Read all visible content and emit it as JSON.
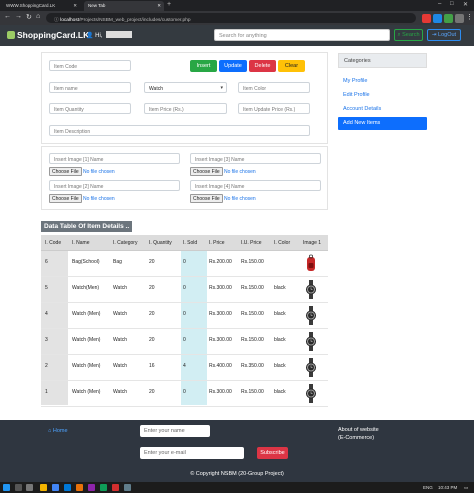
{
  "browser": {
    "tabs": [
      {
        "label": "WWW.ShoppingCard.LK"
      },
      {
        "label": "New Tab"
      }
    ],
    "url_host": "localhost",
    "url_path": "/Projects/NSBM_web_project/includes/customer.php",
    "extensions": [
      {
        "icon": "extension-red-icon",
        "color": "#e53935"
      },
      {
        "icon": "extension-blue-icon",
        "color": "#1e88e5"
      },
      {
        "icon": "extension-green-icon",
        "color": "#43a047"
      },
      {
        "icon": "extension-gray-icon",
        "color": "#757575"
      }
    ]
  },
  "navbar": {
    "brand": "ShoppingCard.LK",
    "greeting": "Hi,",
    "search_placeholder": "Search for anything",
    "search_button": "Search",
    "logout_button": "LogOut"
  },
  "form": {
    "item_code_placeholder": "Item Code",
    "buttons": {
      "insert": "Insert",
      "update": "Update",
      "delete": "Delete",
      "clear": "Clear"
    },
    "item_name_placeholder": "Item name",
    "category_selected": "Watch",
    "item_color_placeholder": "Item Color",
    "item_quantity_placeholder": "Item Quantity",
    "item_price_placeholder": "Item Price (Rs.)",
    "item_update_price_placeholder": "Item Update Price (Rs.)",
    "item_description_placeholder": "Item Description",
    "images": [
      {
        "placeholder": "Insert Image [1] Name"
      },
      {
        "placeholder": "Insert Image [2] Name"
      },
      {
        "placeholder": "Insert Image [3] Name"
      },
      {
        "placeholder": "Insert Image [4] Name"
      }
    ],
    "choose_file": "Choose File",
    "no_file": "No file chosen"
  },
  "sidebar": {
    "header": "Categories",
    "items": [
      {
        "label": "My Profile"
      },
      {
        "label": "Edit Profile"
      },
      {
        "label": "Account Details"
      },
      {
        "label": "Add New Items"
      }
    ]
  },
  "table": {
    "title": "Data Table Of Item Details ..",
    "headers": [
      "I. Code",
      "I. Name",
      "I. Category",
      "I. Quantity",
      "I. Sold",
      "I. Price",
      "I.U. Price",
      "I. Color",
      "Image 1"
    ],
    "rows": [
      {
        "code": "6",
        "name": "Bag(School)",
        "category": "Bag",
        "quantity": "20",
        "sold": "0",
        "price": "Rs.200.00",
        "uprice": "Rs.150.00",
        "color": "",
        "image": "backpack-thumbnail"
      },
      {
        "code": "5",
        "name": "Watch(Men)",
        "category": "Watch",
        "quantity": "20",
        "sold": "0",
        "price": "Rs.300.00",
        "uprice": "Rs.150.00",
        "color": "black",
        "image": "watch-thumbnail"
      },
      {
        "code": "4",
        "name": "Watch (Men)",
        "category": "Watch",
        "quantity": "20",
        "sold": "0",
        "price": "Rs.300.00",
        "uprice": "Rs.150.00",
        "color": "black",
        "image": "watch-thumbnail"
      },
      {
        "code": "3",
        "name": "Watch (Men)",
        "category": "Watch",
        "quantity": "20",
        "sold": "0",
        "price": "Rs.300.00",
        "uprice": "Rs.150.00",
        "color": "black",
        "image": "watch-thumbnail"
      },
      {
        "code": "2",
        "name": "Watch (Men)",
        "category": "Watch",
        "quantity": "16",
        "sold": "4",
        "price": "Rs.400.00",
        "uprice": "Rs.350.00",
        "color": "black",
        "image": "watch-thumbnail"
      },
      {
        "code": "1",
        "name": "Watch (Men)",
        "category": "Watch",
        "quantity": "20",
        "sold": "0",
        "price": "Rs.300.00",
        "uprice": "Rs.150.00",
        "color": "black",
        "image": "watch-thumbnail"
      }
    ]
  },
  "footer": {
    "home_link": "Home",
    "name_placeholder": "Enter your name",
    "email_placeholder": "Enter your e-mail",
    "subscribe_button": "Subscribe",
    "about_title": "About of website",
    "about_sub": "(E-Commerce)",
    "copyright": "© Copyright NSBM (20-Group Project)"
  },
  "taskbar": {
    "language": "ENG",
    "time": "10:43 PM"
  },
  "colors": {
    "navbar": "#343a40",
    "footer": "#2f3640",
    "insert": "#28a745",
    "update": "#0d6efd",
    "delete": "#dc3545",
    "clear": "#ffc107",
    "active_sidebar": "#0d6efd",
    "sold_column": "#d2eef3"
  }
}
